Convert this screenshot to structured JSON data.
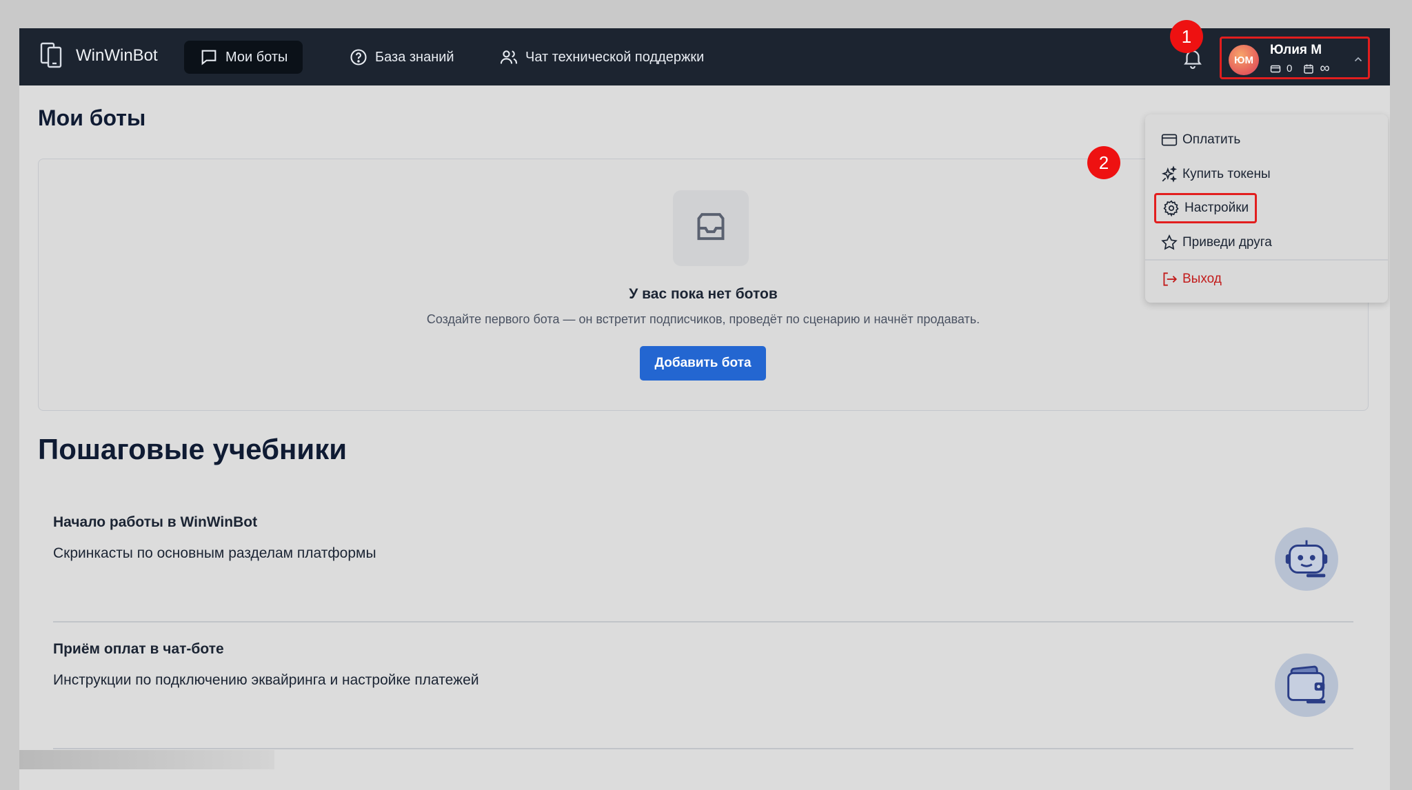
{
  "app": {
    "name": "WinWinBot"
  },
  "nav": {
    "items": [
      {
        "label": "Мои боты",
        "icon": "chat-bubble-icon",
        "active": true
      },
      {
        "label": "База знаний",
        "icon": "help-circle-icon",
        "active": false
      },
      {
        "label": "Чат технической поддержки",
        "icon": "users-icon",
        "active": false
      }
    ]
  },
  "user": {
    "initials": "ЮМ",
    "name": "Юлия М",
    "balance": "0",
    "plan_symbol": "∞"
  },
  "badges": {
    "first": "1",
    "second": "2"
  },
  "menu": {
    "items": [
      {
        "label": "Оплатить",
        "icon": "credit-card-icon"
      },
      {
        "label": "Купить токены",
        "icon": "sparkles-icon"
      },
      {
        "label": "Настройки",
        "icon": "gear-icon"
      },
      {
        "label": "Приведи друга",
        "icon": "star-icon"
      },
      {
        "label": "Выход",
        "icon": "logout-icon"
      }
    ]
  },
  "main": {
    "title": "Мои боты",
    "empty": {
      "title": "У вас пока нет ботов",
      "subtitle": "Создайте первого бота — он встретит подписчиков, проведёт по сценарию и начнёт продавать.",
      "button": "Добавить бота"
    }
  },
  "tutorials": {
    "title": "Пошаговые учебники",
    "items": [
      {
        "title": "Начало работы в WinWinBot",
        "description": "Скринкасты по основным разделам платформы",
        "icon": "robot-icon"
      },
      {
        "title": "Приём оплат в чат-боте",
        "description": "Инструкции по подключению эквайринга и настройке платежей",
        "icon": "wallet-icon"
      }
    ]
  },
  "colors": {
    "accent": "#2366d1",
    "topbar": "#1c2430",
    "highlight": "#e21e1e",
    "logout": "#c21b1b"
  }
}
